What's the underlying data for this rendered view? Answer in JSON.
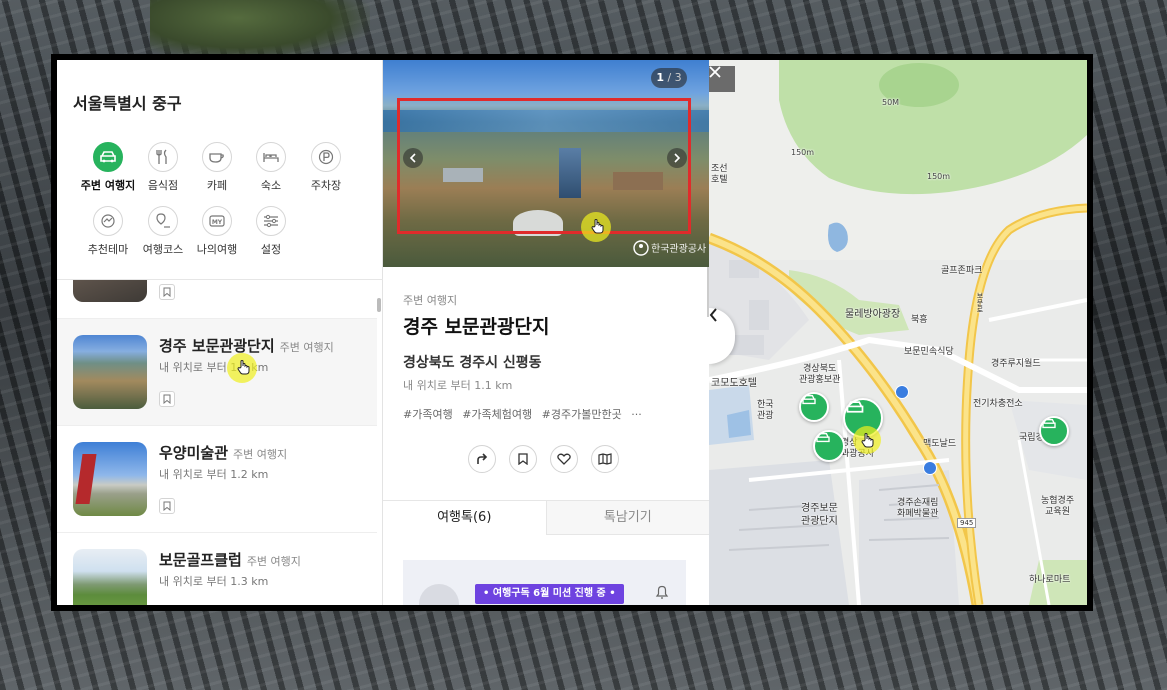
{
  "left_panel": {
    "region": "서울특별시 중구",
    "categories": [
      {
        "label": "주변 여행지",
        "icon": "car-icon",
        "active": true
      },
      {
        "label": "음식점",
        "icon": "fork-knife-icon",
        "active": false
      },
      {
        "label": "카페",
        "icon": "coffee-cup-icon",
        "active": false
      },
      {
        "label": "숙소",
        "icon": "bed-icon",
        "active": false
      },
      {
        "label": "주차장",
        "icon": "parking-icon",
        "active": false
      },
      {
        "label": "추천테마",
        "icon": "theme-icon",
        "active": false
      },
      {
        "label": "여행코스",
        "icon": "course-icon",
        "active": false
      },
      {
        "label": "나의여행",
        "icon": "my-trip-icon",
        "active": false
      },
      {
        "label": "설정",
        "icon": "settings-sliders-icon",
        "active": false
      }
    ],
    "list": [
      {
        "name": "경주 보문관광단지",
        "type": "주변 여행지",
        "distance": "내 위치로 부터 1.1 km"
      },
      {
        "name": "우양미술관",
        "type": "주변 여행지",
        "distance": "내 위치로 부터 1.2 km"
      },
      {
        "name": "보문골프클럽",
        "type": "주변 여행지",
        "distance": "내 위치로 부터 1.3 km"
      }
    ]
  },
  "detail": {
    "pager_current": "1",
    "pager_total": "/ 3",
    "category": "주변 여행지",
    "title": "경주 보문관광단지",
    "address": "경상북도 경주시 신평동",
    "distance": "내 위치로 부터 1.1 km",
    "tags": [
      "#가족여행",
      "#가족체험여행",
      "#경주가볼만한곳",
      "···"
    ],
    "tabs": [
      {
        "label": "여행톡(6)",
        "active": true
      },
      {
        "label": "톡남기기",
        "active": false
      }
    ],
    "promo_text": "• 여행구독 6월 미션 진행 중 •",
    "watermark": "한국관광공사"
  },
  "map": {
    "labels": {
      "m50": "50M",
      "m150a": "150m",
      "m150b": "150m",
      "hotel": "조선\n호텔",
      "golf": "골프존파크",
      "lake": "물레방아광장",
      "bukheung": "북흥",
      "folk": "보문민속식당",
      "world": "경주루지월드",
      "kodo": "코모도호텔",
      "promo": "경상북도\n관광홍보관",
      "charging": "전기차충전소",
      "hanguk": "한국\n관광",
      "mcd": "맥도날드",
      "guknip": "국립경",
      "gyeongju_sa": "경상\n과광공사",
      "museum": "경주손재림\n화폐박물관",
      "bomun": "경주보문\n관광단지",
      "nonghyup": "농협경주\n교육원",
      "hanaro": "하나로마트",
      "road": "945",
      "road_name": "보문로"
    }
  },
  "colors": {
    "accent_green": "#27b35d",
    "highlight_red": "#e02b2b",
    "promo_purple": "#6e43e0"
  }
}
